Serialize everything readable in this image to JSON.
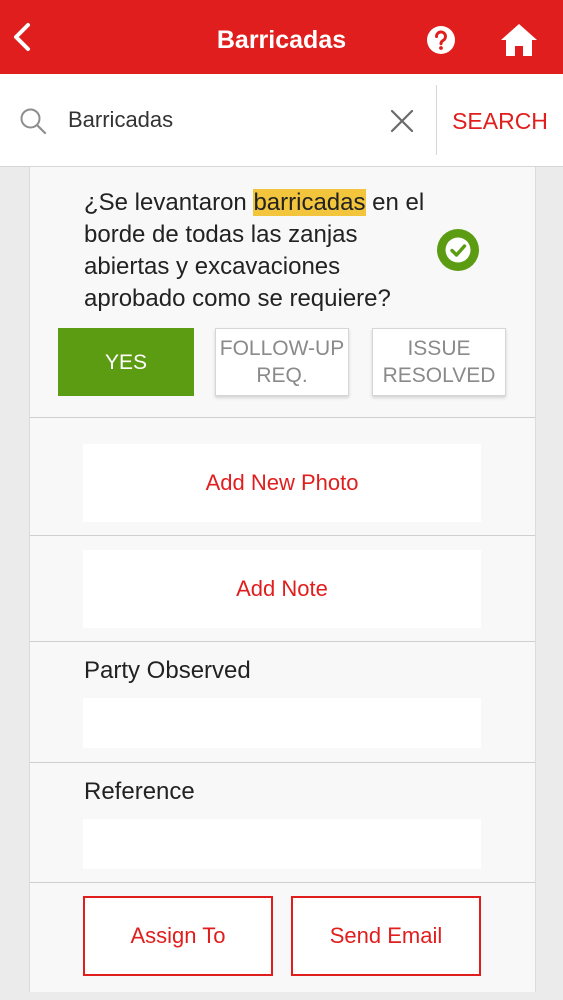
{
  "header": {
    "title": "Barricadas",
    "back_icon": "chevron-left-icon",
    "help_icon": "help-circle-icon",
    "home_icon": "home-icon",
    "bar_color": "#e01e1e"
  },
  "search": {
    "icon": "search-icon",
    "value": "Barricadas",
    "clear_icon": "close-icon",
    "button_label": "SEARCH"
  },
  "item": {
    "question_before": "¿Se levantaron ",
    "question_highlight": "barricadas",
    "question_after": " en el borde de todas las zanjas abiertas y excavaciones aprobado como se requiere?",
    "highlight_color": "#f2c53d",
    "status_icon": "check-circle-icon",
    "status_color": "#5c9c12",
    "options": {
      "yes": "YES",
      "follow_up_line1": "FOLLOW-UP",
      "follow_up_line2": "REQ.",
      "resolved_line1": "ISSUE",
      "resolved_line2": "RESOLVED"
    },
    "selected_option": "YES",
    "add_photo_label": "Add New Photo",
    "add_note_label": "Add Note",
    "party_observed_label": "Party Observed",
    "party_observed_value": "",
    "reference_label": "Reference",
    "reference_value": "",
    "assign_label": "Assign To",
    "email_label": "Send Email"
  }
}
